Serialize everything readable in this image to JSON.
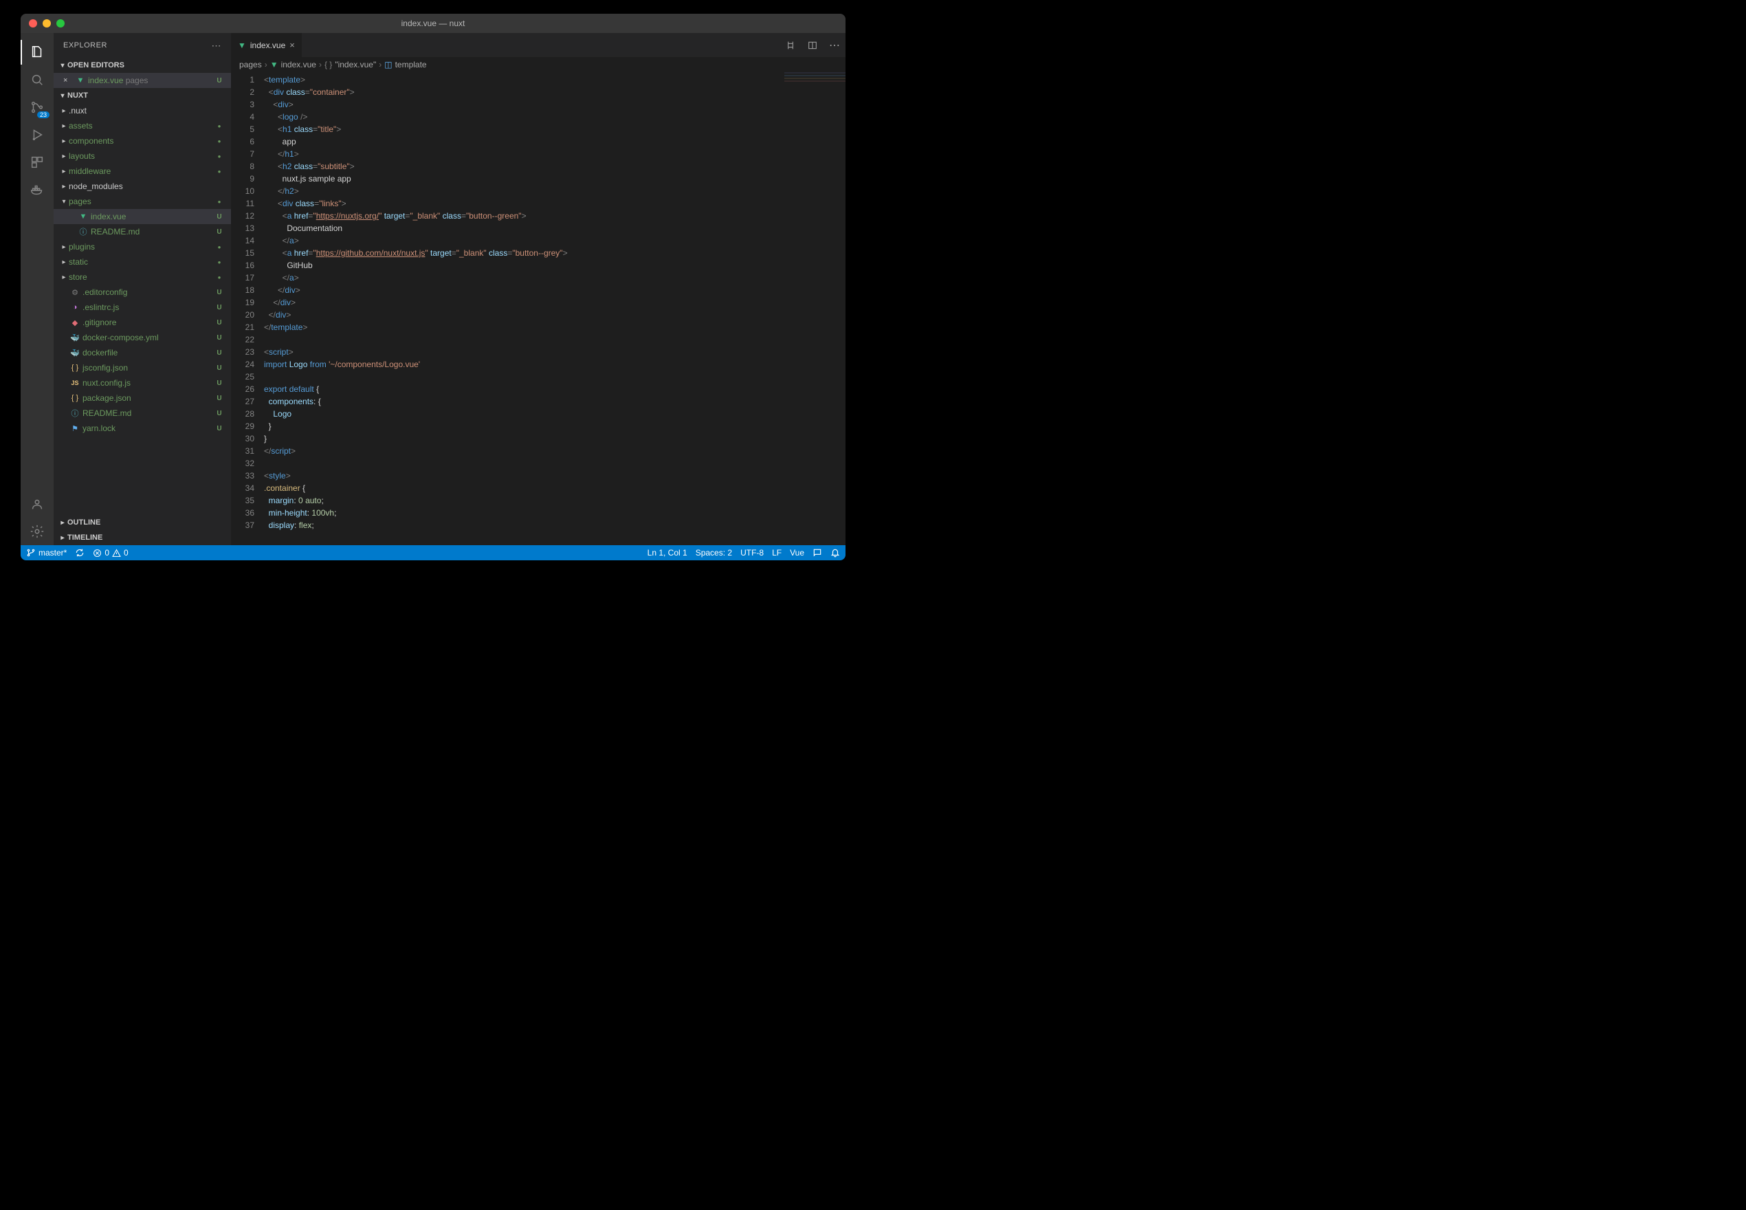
{
  "titlebar": {
    "title": "index.vue — nuxt"
  },
  "activitybar": {
    "scm_badge": "23"
  },
  "sidebar": {
    "title": "EXPLORER",
    "sections": {
      "open_editors": "OPEN EDITORS",
      "workspace": "NUXT",
      "outline": "OUTLINE",
      "timeline": "TIMELINE"
    },
    "open_editors": [
      {
        "label": "index.vue",
        "desc": "pages",
        "status": "U",
        "icon": "vue"
      }
    ],
    "tree": [
      {
        "d": 1,
        "type": "folder",
        "label": ".nuxt",
        "expanded": false,
        "status": ""
      },
      {
        "d": 1,
        "type": "folder",
        "label": "assets",
        "expanded": false,
        "status": "dot",
        "git": true
      },
      {
        "d": 1,
        "type": "folder",
        "label": "components",
        "expanded": false,
        "status": "dot",
        "git": true
      },
      {
        "d": 1,
        "type": "folder",
        "label": "layouts",
        "expanded": false,
        "status": "dot",
        "git": true
      },
      {
        "d": 1,
        "type": "folder",
        "label": "middleware",
        "expanded": false,
        "status": "dot",
        "git": true
      },
      {
        "d": 1,
        "type": "folder",
        "label": "node_modules",
        "expanded": false,
        "status": ""
      },
      {
        "d": 1,
        "type": "folder",
        "label": "pages",
        "expanded": true,
        "status": "dot",
        "git": true
      },
      {
        "d": 2,
        "type": "file",
        "label": "index.vue",
        "status": "U",
        "icon": "vue",
        "git": true,
        "active": true
      },
      {
        "d": 2,
        "type": "file",
        "label": "README.md",
        "status": "U",
        "icon": "info",
        "git": true
      },
      {
        "d": 1,
        "type": "folder",
        "label": "plugins",
        "expanded": false,
        "status": "dot",
        "git": true
      },
      {
        "d": 1,
        "type": "folder",
        "label": "static",
        "expanded": false,
        "status": "dot",
        "git": true
      },
      {
        "d": 1,
        "type": "folder",
        "label": "store",
        "expanded": false,
        "status": "dot",
        "git": true
      },
      {
        "d": 1,
        "type": "file",
        "label": ".editorconfig",
        "status": "U",
        "icon": "gear",
        "git": true
      },
      {
        "d": 1,
        "type": "file",
        "label": ".eslintrc.js",
        "status": "U",
        "icon": "eslint",
        "git": true
      },
      {
        "d": 1,
        "type": "file",
        "label": ".gitignore",
        "status": "U",
        "icon": "git",
        "git": true
      },
      {
        "d": 1,
        "type": "file",
        "label": "docker-compose.yml",
        "status": "U",
        "icon": "docker",
        "git": true
      },
      {
        "d": 1,
        "type": "file",
        "label": "dockerfile",
        "status": "U",
        "icon": "docker",
        "git": true
      },
      {
        "d": 1,
        "type": "file",
        "label": "jsconfig.json",
        "status": "U",
        "icon": "json",
        "git": true
      },
      {
        "d": 1,
        "type": "file",
        "label": "nuxt.config.js",
        "status": "U",
        "icon": "js",
        "git": true
      },
      {
        "d": 1,
        "type": "file",
        "label": "package.json",
        "status": "U",
        "icon": "json",
        "git": true
      },
      {
        "d": 1,
        "type": "file",
        "label": "README.md",
        "status": "U",
        "icon": "info",
        "git": true
      },
      {
        "d": 1,
        "type": "file",
        "label": "yarn.lock",
        "status": "U",
        "icon": "yarn",
        "git": true
      }
    ]
  },
  "tabs": [
    {
      "label": "index.vue",
      "icon": "vue"
    }
  ],
  "breadcrumbs": [
    {
      "label": "pages",
      "icon": ""
    },
    {
      "label": "index.vue",
      "icon": "vue"
    },
    {
      "label": "\"index.vue\"",
      "icon": "braces"
    },
    {
      "label": "template",
      "icon": "box"
    }
  ],
  "code": [
    [
      [
        "t-tag",
        "<"
      ],
      [
        "t-el",
        "template"
      ],
      [
        "t-tag",
        ">"
      ]
    ],
    [
      [
        "",
        "  "
      ],
      [
        "t-tag",
        "<"
      ],
      [
        "t-el",
        "div"
      ],
      [
        "",
        " "
      ],
      [
        "t-attr",
        "class"
      ],
      [
        "t-tag",
        "="
      ],
      [
        "t-str",
        "\"container\""
      ],
      [
        "t-tag",
        ">"
      ]
    ],
    [
      [
        "",
        "    "
      ],
      [
        "t-tag",
        "<"
      ],
      [
        "t-el",
        "div"
      ],
      [
        "t-tag",
        ">"
      ]
    ],
    [
      [
        "",
        "      "
      ],
      [
        "t-tag",
        "<"
      ],
      [
        "t-el",
        "logo"
      ],
      [
        "",
        " "
      ],
      [
        "t-tag",
        "/>"
      ]
    ],
    [
      [
        "",
        "      "
      ],
      [
        "t-tag",
        "<"
      ],
      [
        "t-el",
        "h1"
      ],
      [
        "",
        " "
      ],
      [
        "t-attr",
        "class"
      ],
      [
        "t-tag",
        "="
      ],
      [
        "t-str",
        "\"title\""
      ],
      [
        "t-tag",
        ">"
      ]
    ],
    [
      [
        "",
        "        "
      ],
      [
        "t-text",
        "app"
      ]
    ],
    [
      [
        "",
        "      "
      ],
      [
        "t-tag",
        "</"
      ],
      [
        "t-el",
        "h1"
      ],
      [
        "t-tag",
        ">"
      ]
    ],
    [
      [
        "",
        "      "
      ],
      [
        "t-tag",
        "<"
      ],
      [
        "t-el",
        "h2"
      ],
      [
        "",
        " "
      ],
      [
        "t-attr",
        "class"
      ],
      [
        "t-tag",
        "="
      ],
      [
        "t-str",
        "\"subtitle\""
      ],
      [
        "t-tag",
        ">"
      ]
    ],
    [
      [
        "",
        "        "
      ],
      [
        "t-text",
        "nuxt.js sample app"
      ]
    ],
    [
      [
        "",
        "      "
      ],
      [
        "t-tag",
        "</"
      ],
      [
        "t-el",
        "h2"
      ],
      [
        "t-tag",
        ">"
      ]
    ],
    [
      [
        "",
        "      "
      ],
      [
        "t-tag",
        "<"
      ],
      [
        "t-el",
        "div"
      ],
      [
        "",
        " "
      ],
      [
        "t-attr",
        "class"
      ],
      [
        "t-tag",
        "="
      ],
      [
        "t-str",
        "\"links\""
      ],
      [
        "t-tag",
        ">"
      ]
    ],
    [
      [
        "",
        "        "
      ],
      [
        "t-tag",
        "<"
      ],
      [
        "t-el",
        "a"
      ],
      [
        "",
        " "
      ],
      [
        "t-attr",
        "href"
      ],
      [
        "t-tag",
        "="
      ],
      [
        "t-str",
        "\""
      ],
      [
        "t-link",
        "https://nuxtjs.org/"
      ],
      [
        "t-str",
        "\""
      ],
      [
        "",
        " "
      ],
      [
        "t-attr",
        "target"
      ],
      [
        "t-tag",
        "="
      ],
      [
        "t-str",
        "\"_blank\""
      ],
      [
        "",
        " "
      ],
      [
        "t-attr",
        "class"
      ],
      [
        "t-tag",
        "="
      ],
      [
        "t-str",
        "\"button--green\""
      ],
      [
        "t-tag",
        ">"
      ]
    ],
    [
      [
        "",
        "          "
      ],
      [
        "t-text",
        "Documentation"
      ]
    ],
    [
      [
        "",
        "        "
      ],
      [
        "t-tag",
        "</"
      ],
      [
        "t-el",
        "a"
      ],
      [
        "t-tag",
        ">"
      ]
    ],
    [
      [
        "",
        "        "
      ],
      [
        "t-tag",
        "<"
      ],
      [
        "t-el",
        "a"
      ],
      [
        "",
        " "
      ],
      [
        "t-attr",
        "href"
      ],
      [
        "t-tag",
        "="
      ],
      [
        "t-str",
        "\""
      ],
      [
        "t-link",
        "https://github.com/nuxt/nuxt.js"
      ],
      [
        "t-str",
        "\""
      ],
      [
        "",
        " "
      ],
      [
        "t-attr",
        "target"
      ],
      [
        "t-tag",
        "="
      ],
      [
        "t-str",
        "\"_blank\""
      ],
      [
        "",
        " "
      ],
      [
        "t-attr",
        "class"
      ],
      [
        "t-tag",
        "="
      ],
      [
        "t-str",
        "\"button--grey\""
      ],
      [
        "t-tag",
        ">"
      ]
    ],
    [
      [
        "",
        "          "
      ],
      [
        "t-text",
        "GitHub"
      ]
    ],
    [
      [
        "",
        "        "
      ],
      [
        "t-tag",
        "</"
      ],
      [
        "t-el",
        "a"
      ],
      [
        "t-tag",
        ">"
      ]
    ],
    [
      [
        "",
        "      "
      ],
      [
        "t-tag",
        "</"
      ],
      [
        "t-el",
        "div"
      ],
      [
        "t-tag",
        ">"
      ]
    ],
    [
      [
        "",
        "    "
      ],
      [
        "t-tag",
        "</"
      ],
      [
        "t-el",
        "div"
      ],
      [
        "t-tag",
        ">"
      ]
    ],
    [
      [
        "",
        "  "
      ],
      [
        "t-tag",
        "</"
      ],
      [
        "t-el",
        "div"
      ],
      [
        "t-tag",
        ">"
      ]
    ],
    [
      [
        "t-tag",
        "</"
      ],
      [
        "t-el",
        "template"
      ],
      [
        "t-tag",
        ">"
      ]
    ],
    [],
    [
      [
        "t-tag",
        "<"
      ],
      [
        "t-el",
        "script"
      ],
      [
        "t-tag",
        ">"
      ]
    ],
    [
      [
        "t-kw",
        "import"
      ],
      [
        "",
        " "
      ],
      [
        "t-id",
        "Logo"
      ],
      [
        "",
        " "
      ],
      [
        "t-kw",
        "from"
      ],
      [
        "",
        " "
      ],
      [
        "t-str",
        "'~/components/Logo.vue'"
      ]
    ],
    [],
    [
      [
        "t-kw",
        "export"
      ],
      [
        "",
        " "
      ],
      [
        "t-kw",
        "default"
      ],
      [
        "",
        " "
      ],
      [
        "t-pun",
        "{"
      ]
    ],
    [
      [
        "",
        "  "
      ],
      [
        "t-id",
        "components"
      ],
      [
        "t-pun",
        ":"
      ],
      [
        "",
        " "
      ],
      [
        "t-pun",
        "{"
      ]
    ],
    [
      [
        "",
        "    "
      ],
      [
        "t-id",
        "Logo"
      ]
    ],
    [
      [
        "",
        "  "
      ],
      [
        "t-pun",
        "}"
      ]
    ],
    [
      [
        "t-pun",
        "}"
      ]
    ],
    [
      [
        "t-tag",
        "</"
      ],
      [
        "t-el",
        "script"
      ],
      [
        "t-tag",
        ">"
      ]
    ],
    [],
    [
      [
        "t-tag",
        "<"
      ],
      [
        "t-el",
        "style"
      ],
      [
        "t-tag",
        ">"
      ]
    ],
    [
      [
        "t-sel",
        ".container"
      ],
      [
        "",
        " "
      ],
      [
        "t-pun",
        "{"
      ]
    ],
    [
      [
        "",
        "  "
      ],
      [
        "t-attr",
        "margin"
      ],
      [
        "t-pun",
        ":"
      ],
      [
        "",
        " "
      ],
      [
        "t-num",
        "0"
      ],
      [
        "",
        " "
      ],
      [
        "t-num",
        "auto"
      ],
      [
        "t-pun",
        ";"
      ]
    ],
    [
      [
        "",
        "  "
      ],
      [
        "t-attr",
        "min-height"
      ],
      [
        "t-pun",
        ":"
      ],
      [
        "",
        " "
      ],
      [
        "t-num",
        "100vh"
      ],
      [
        "t-pun",
        ";"
      ]
    ],
    [
      [
        "",
        "  "
      ],
      [
        "t-attr",
        "display"
      ],
      [
        "t-pun",
        ":"
      ],
      [
        "",
        " "
      ],
      [
        "t-num",
        "flex"
      ],
      [
        "t-pun",
        ";"
      ]
    ]
  ],
  "status": {
    "branch": "master*",
    "errors": "0",
    "warnings": "0",
    "position": "Ln 1, Col 1",
    "spaces": "Spaces: 2",
    "encoding": "UTF-8",
    "eol": "LF",
    "language": "Vue"
  }
}
